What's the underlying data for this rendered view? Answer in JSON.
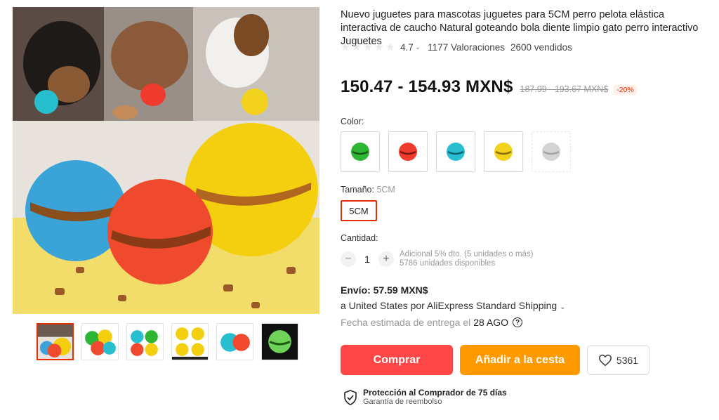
{
  "product": {
    "title": "Nuevo juguetes para mascotas juguetes para 5CM perro pelota elástica interactiva de caucho Natural goteando bola diente limpio gato perro interactivo Juguetes",
    "rating": "4.7",
    "reviews": "1177 Valoraciones",
    "sold": "2600 vendidos"
  },
  "price": {
    "current": "150.47 - 154.93 MXN$",
    "original": "187.99 - 193.67 MXN$",
    "discount": "-20%"
  },
  "color": {
    "label": "Color:",
    "options": [
      {
        "name": "green-ball",
        "color": "#2fb534"
      },
      {
        "name": "red-ball",
        "color": "#ef3b2d"
      },
      {
        "name": "blue-ball",
        "color": "#27bfd0"
      },
      {
        "name": "yellow-ball",
        "color": "#f2d21c"
      },
      {
        "name": "gray-ball",
        "color": "#b8b8b8"
      }
    ]
  },
  "size": {
    "label": "Tamaño:",
    "selected": "5CM",
    "option": "5CM"
  },
  "quantity": {
    "label": "Cantidad:",
    "value": "1",
    "minus": "−",
    "plus": "+",
    "discount_note": "Adicional 5% dto. (5 unidades o más)",
    "available": "5786 unidades disponibles"
  },
  "shipping": {
    "title": "Envío: 57.59 MXN$",
    "detail": "a United States por AliExpress Standard Shipping",
    "date_label": "Fecha estimada de entrega el",
    "date": "28 AGO",
    "help_icon": "?"
  },
  "actions": {
    "buy": "Comprar",
    "cart": "Añadir a la cesta",
    "wishlist_count": "5361"
  },
  "protection": {
    "title": "Protección al Comprador de 75 días",
    "subtitle": "Garantía de reembolso"
  },
  "colors": {
    "accent": "#e62e04",
    "buy": "#ff4747",
    "cart": "#ff9900"
  }
}
